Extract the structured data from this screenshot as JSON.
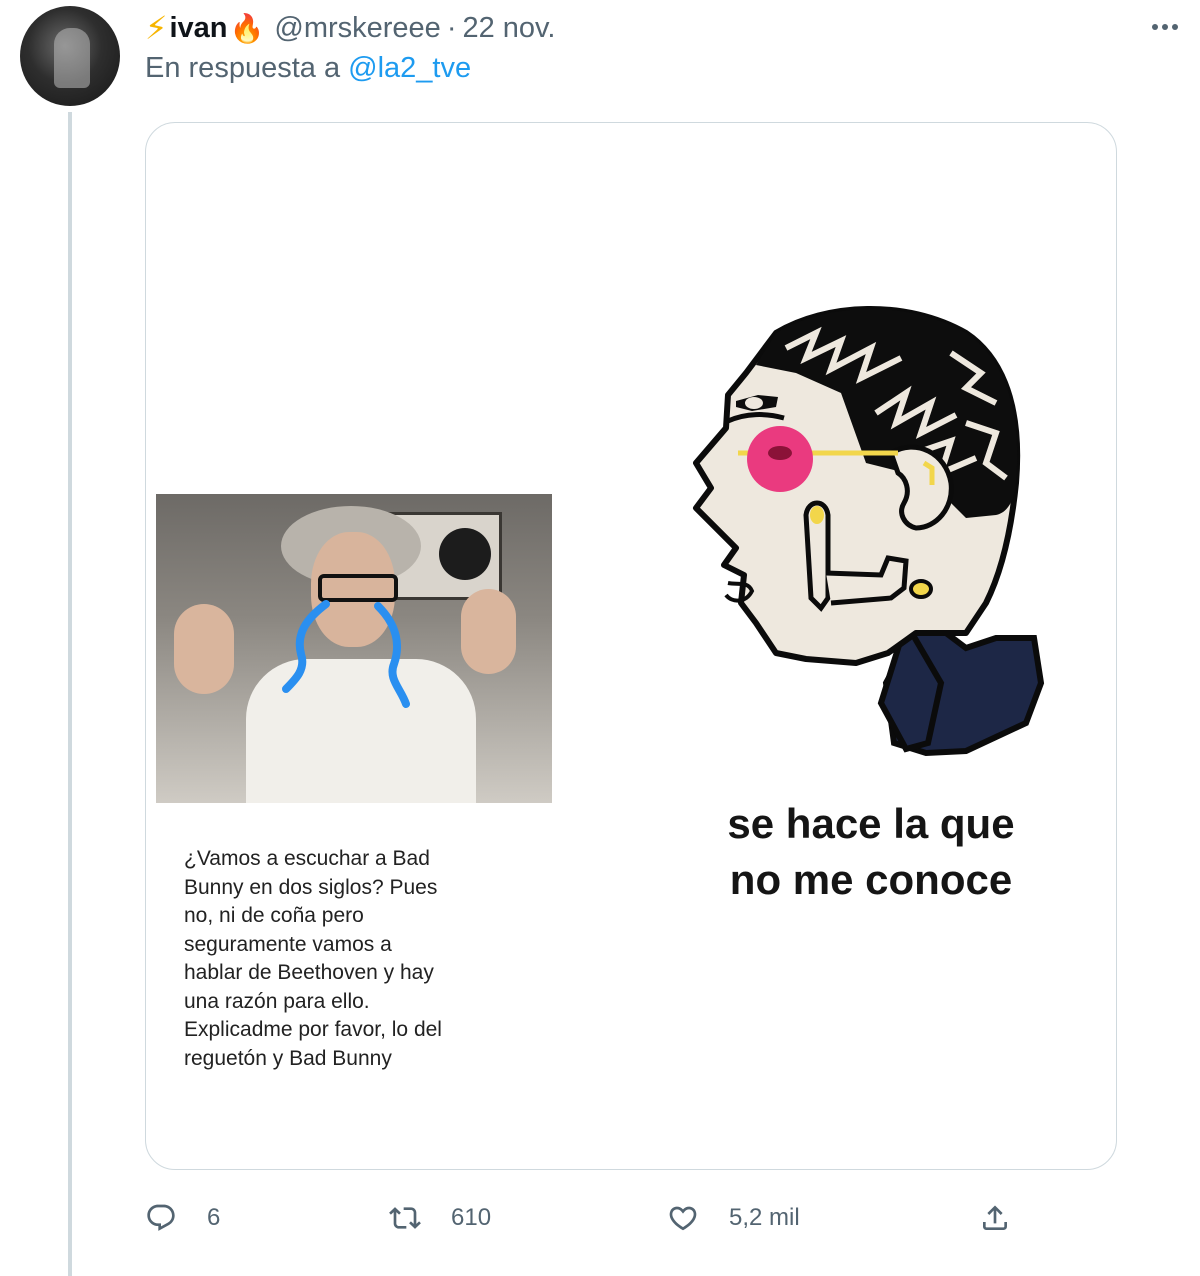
{
  "tweet": {
    "author": {
      "name": "ivan",
      "name_prefix_emoji": "⚡",
      "name_suffix_emoji": "🔥",
      "handle": "@mrskereee",
      "separator": "·",
      "date": "22 nov."
    },
    "reply": {
      "prefix": "En respuesta a",
      "mention": "@la2_tve"
    },
    "media": {
      "left_caption": "¿Vamos a escuchar a Bad Bunny en dos siglos? Pues no, ni de coña pero seguramente vamos a hablar de Beethoven y hay una razón para ello. Explicadme por favor, lo del reguetón y Bad Bunny",
      "right_caption_line1": "se hace la que",
      "right_caption_line2": "no me conoce"
    },
    "actions": {
      "replies": "6",
      "retweets": "610",
      "likes": "5,2 mil"
    }
  },
  "colors": {
    "link": "#1d9bf0",
    "secondary_text": "#536471",
    "border": "#cfd9de",
    "tear": "#2a8ff0",
    "cheek": "#ea3a7f"
  },
  "icons": {
    "more": "more-horizontal-icon",
    "reply": "reply-icon",
    "retweet": "retweet-icon",
    "like": "heart-icon",
    "share": "share-icon"
  }
}
